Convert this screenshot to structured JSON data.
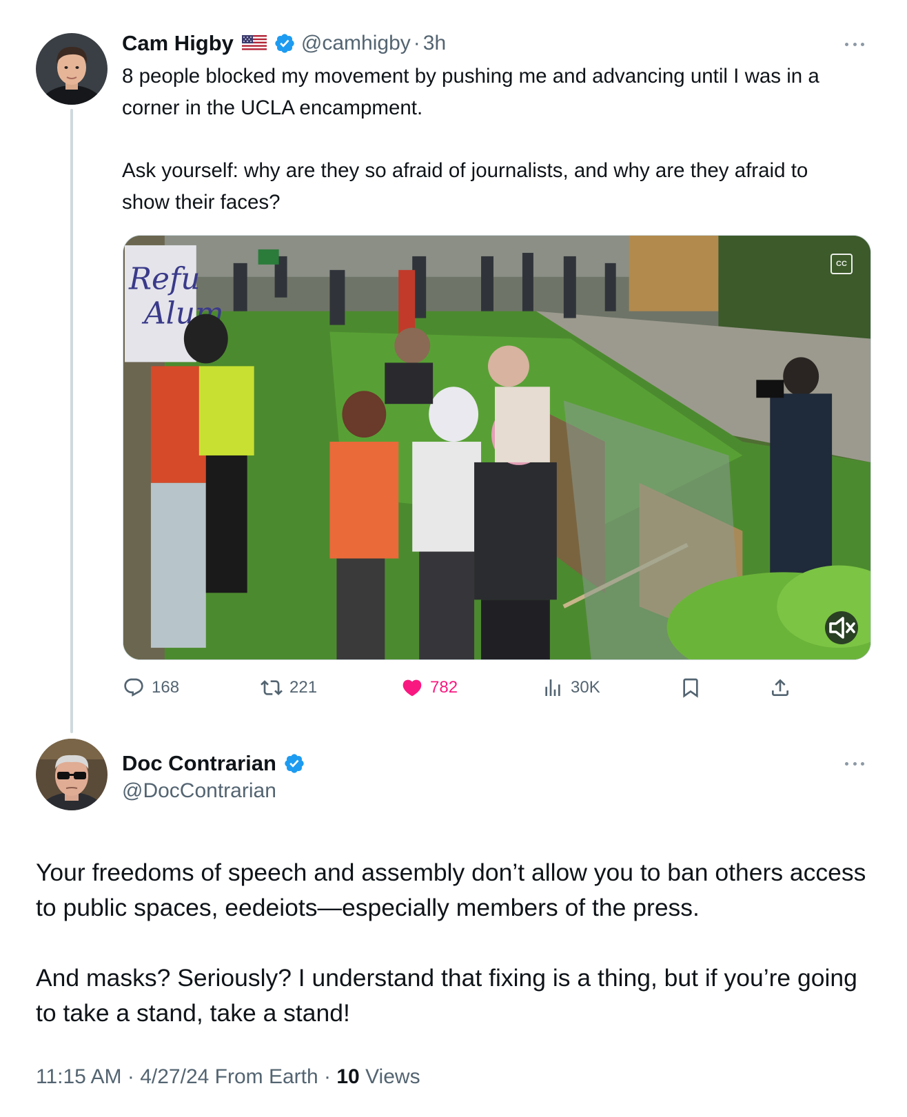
{
  "tweet1": {
    "display_name": "Cam Higby",
    "flag_icon": "us-flag-icon",
    "handle": "@camhigby",
    "separator": "·",
    "time": "3h",
    "text_paragraphs": [
      "8 people blocked my movement by pushing me and advancing until I was in a corner in the UCLA encampment.",
      "Ask yourself: why are they so afraid of journalists, and why are they afraid to show their faces?"
    ],
    "media": {
      "sign_text_lines": [
        "Refu",
        "Alum"
      ],
      "captions_button_label": "CC"
    },
    "actions": {
      "replies": "168",
      "reposts": "221",
      "likes": "782",
      "views": "30K"
    }
  },
  "tweet2": {
    "display_name": "Doc Contrarian",
    "handle": "@DocContrarian",
    "text_paragraphs": [
      "Your freedoms of speech and assembly don’t allow you to ban others access to public spaces, eedeiots—especially members of the press.",
      "And masks? Seriously? I understand that fixing is a thing, but if you’re going to take a stand, take a stand!"
    ],
    "meta": {
      "time": "11:15 AM",
      "date": "4/27/24",
      "source": "From Earth",
      "dot": "·",
      "views_count": "10",
      "views_label": "Views"
    }
  },
  "colors": {
    "text_primary": "#0f1419",
    "text_secondary": "#536471",
    "verified_blue": "#1d9bf0",
    "like_pink": "#f91880",
    "thread_line": "#cfd9de"
  }
}
